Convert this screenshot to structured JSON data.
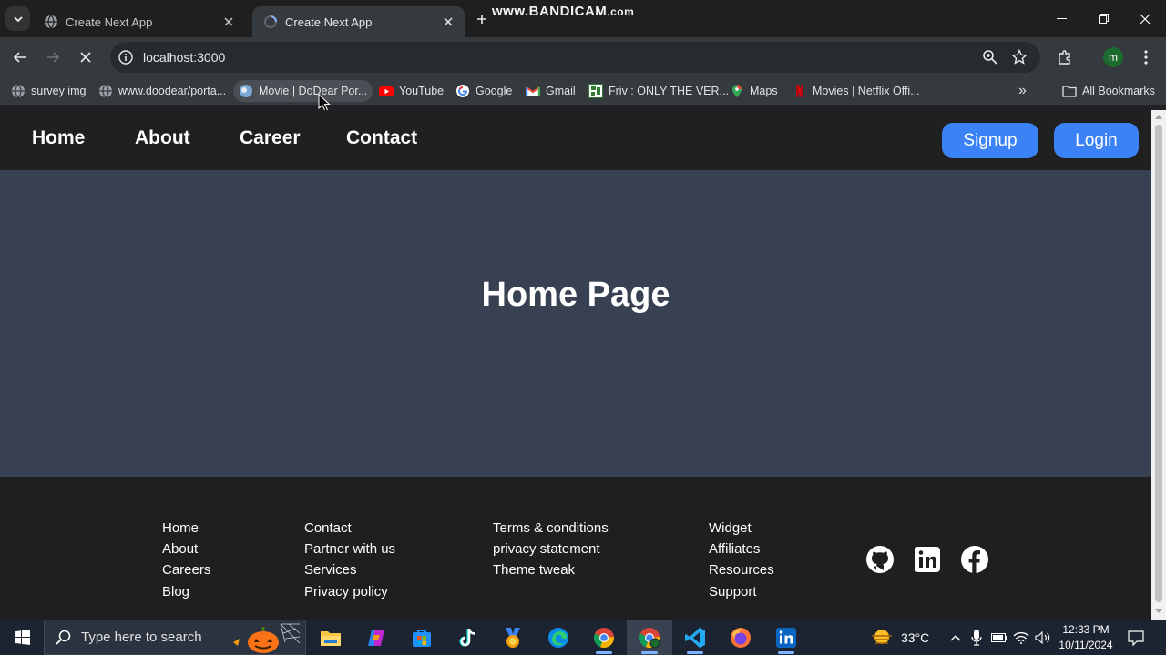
{
  "browser": {
    "tabs": [
      {
        "title": "Create Next App",
        "active": false
      },
      {
        "title": "Create Next App",
        "active": true
      }
    ],
    "watermark": {
      "main": "www.BANDICAM",
      "suffix": ".com"
    },
    "url": "localhost:3000",
    "profile_initial": "m",
    "bookmarks": [
      {
        "label": "survey img",
        "icon": "globe-icon"
      },
      {
        "label": "www.doodear/porta...",
        "icon": "globe-icon"
      },
      {
        "label": "Movie | DoDear Por...",
        "icon": "site-icon"
      },
      {
        "label": "YouTube",
        "icon": "youtube-icon"
      },
      {
        "label": "Google",
        "icon": "google-icon"
      },
      {
        "label": "Gmail",
        "icon": "gmail-icon"
      },
      {
        "label": "Friv : ONLY THE VER...",
        "icon": "friv-icon"
      },
      {
        "label": "Maps",
        "icon": "maps-icon"
      },
      {
        "label": "Movies | Netflix Offi...",
        "icon": "netflix-icon"
      }
    ],
    "all_bookmarks": "All Bookmarks",
    "more_glyph": "»"
  },
  "site": {
    "nav": [
      "Home",
      "About",
      "Career",
      "Contact"
    ],
    "signup": "Signup",
    "login": "Login",
    "hero_title": "Home Page",
    "footer": {
      "columns": [
        [
          "Home",
          "About",
          "Careers",
          "Blog"
        ],
        [
          "Contact",
          "Partner with us",
          "Services",
          "Privacy policy"
        ],
        [
          "Terms & conditions",
          "privacy statement",
          "Theme tweak"
        ],
        [
          "Widget",
          "Affiliates",
          "Resources",
          "Support"
        ]
      ],
      "social": [
        "github-icon",
        "linkedin-icon",
        "facebook-icon"
      ]
    }
  },
  "taskbar": {
    "search_placeholder": "Type here to search",
    "apps": [
      "file-explorer-icon",
      "copilot-icon",
      "store-icon",
      "tiktok-icon",
      "app-medal-icon",
      "edge-icon",
      "chrome-icon",
      "chrome-profile-icon",
      "vscode-icon",
      "firefox-icon",
      "linkedin-app-icon"
    ],
    "temperature": "33°C",
    "time": "12:33 PM",
    "date": "10/11/2024"
  }
}
